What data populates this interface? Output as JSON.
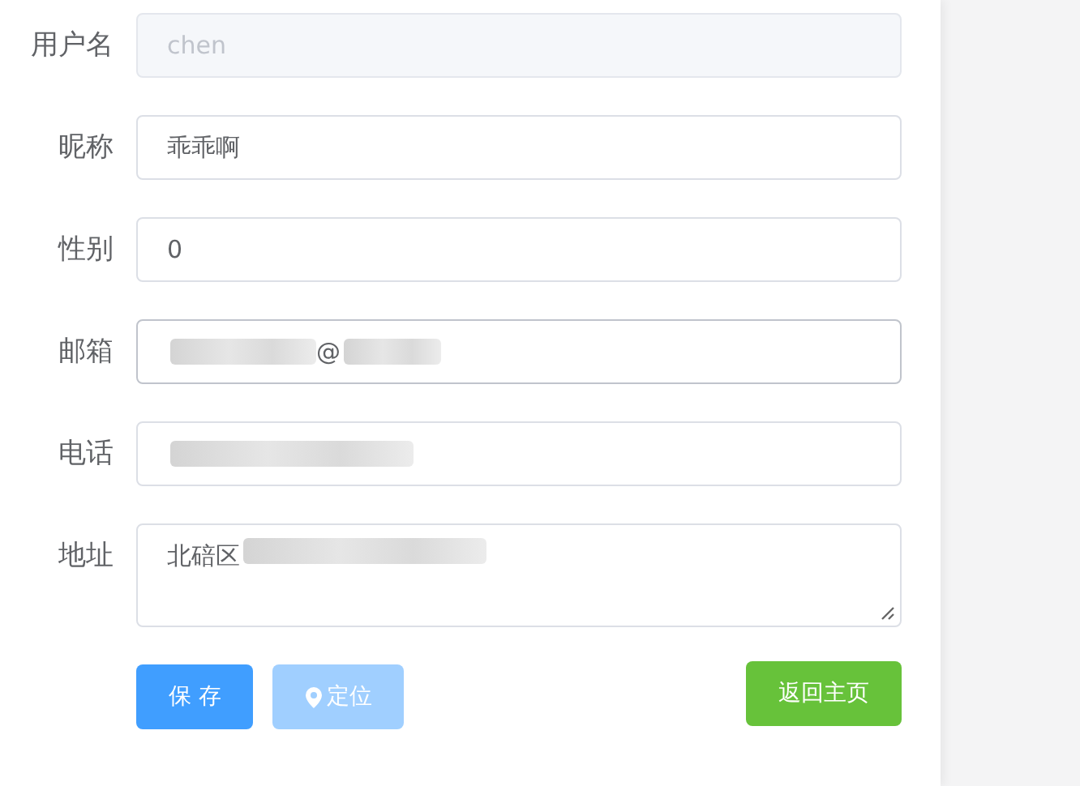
{
  "form": {
    "fields": [
      {
        "label": "用户名",
        "kind": "input",
        "value": "chen",
        "disabled": true,
        "focused": false,
        "redacted": false
      },
      {
        "label": "昵称",
        "kind": "input",
        "value": "乖乖啊",
        "disabled": false,
        "focused": false,
        "redacted": false
      },
      {
        "label": "性别",
        "kind": "input",
        "value": "0",
        "disabled": false,
        "focused": false,
        "redacted": false
      },
      {
        "label": "邮箱",
        "kind": "input",
        "value": "@",
        "disabled": false,
        "focused": true,
        "redacted": true
      },
      {
        "label": "电话",
        "kind": "input",
        "disabled": false,
        "focused": false,
        "redacted": true
      },
      {
        "label": "地址",
        "kind": "textarea",
        "value": "北碚区",
        "disabled": false,
        "focused": false,
        "redacted": true
      }
    ]
  },
  "buttons": [
    {
      "label": "保 存",
      "kind": "primary",
      "disabled": false,
      "icon": false
    },
    {
      "label": "定位",
      "kind": "primary",
      "disabled": true,
      "icon": true
    },
    {
      "label": "返回主页",
      "kind": "success",
      "disabled": false,
      "icon": false
    }
  ]
}
